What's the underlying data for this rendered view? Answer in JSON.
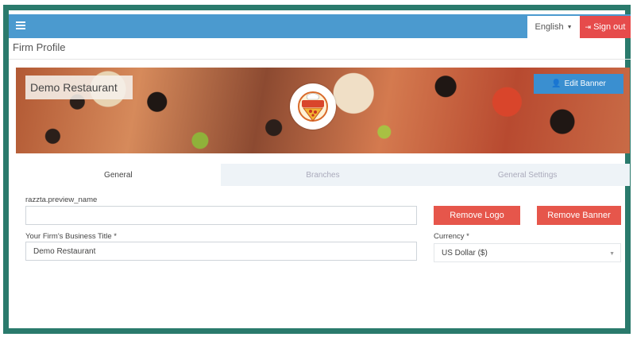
{
  "header": {
    "language": "English",
    "sign_out": "Sign out"
  },
  "breadcrumb": "Firm Profile",
  "banner": {
    "title": "Demo Restaurant",
    "edit_label": "Edit Banner"
  },
  "tabs": [
    {
      "label": "General"
    },
    {
      "label": "Branches"
    },
    {
      "label": "General Settings"
    }
  ],
  "form": {
    "preview_label": "razzta.preview_name",
    "preview_value": "",
    "business_title_label": "Your Firm's Business Title *",
    "business_title_value": "Demo Restaurant",
    "currency_label": "Currency *",
    "currency_value": "US Dollar ($)",
    "remove_logo": "Remove Logo",
    "remove_banner": "Remove Banner"
  },
  "colors": {
    "topbar": "#4b9acf",
    "signout": "#e64b4b",
    "accent_blue": "#3a8fd0",
    "danger": "#e6564b"
  }
}
